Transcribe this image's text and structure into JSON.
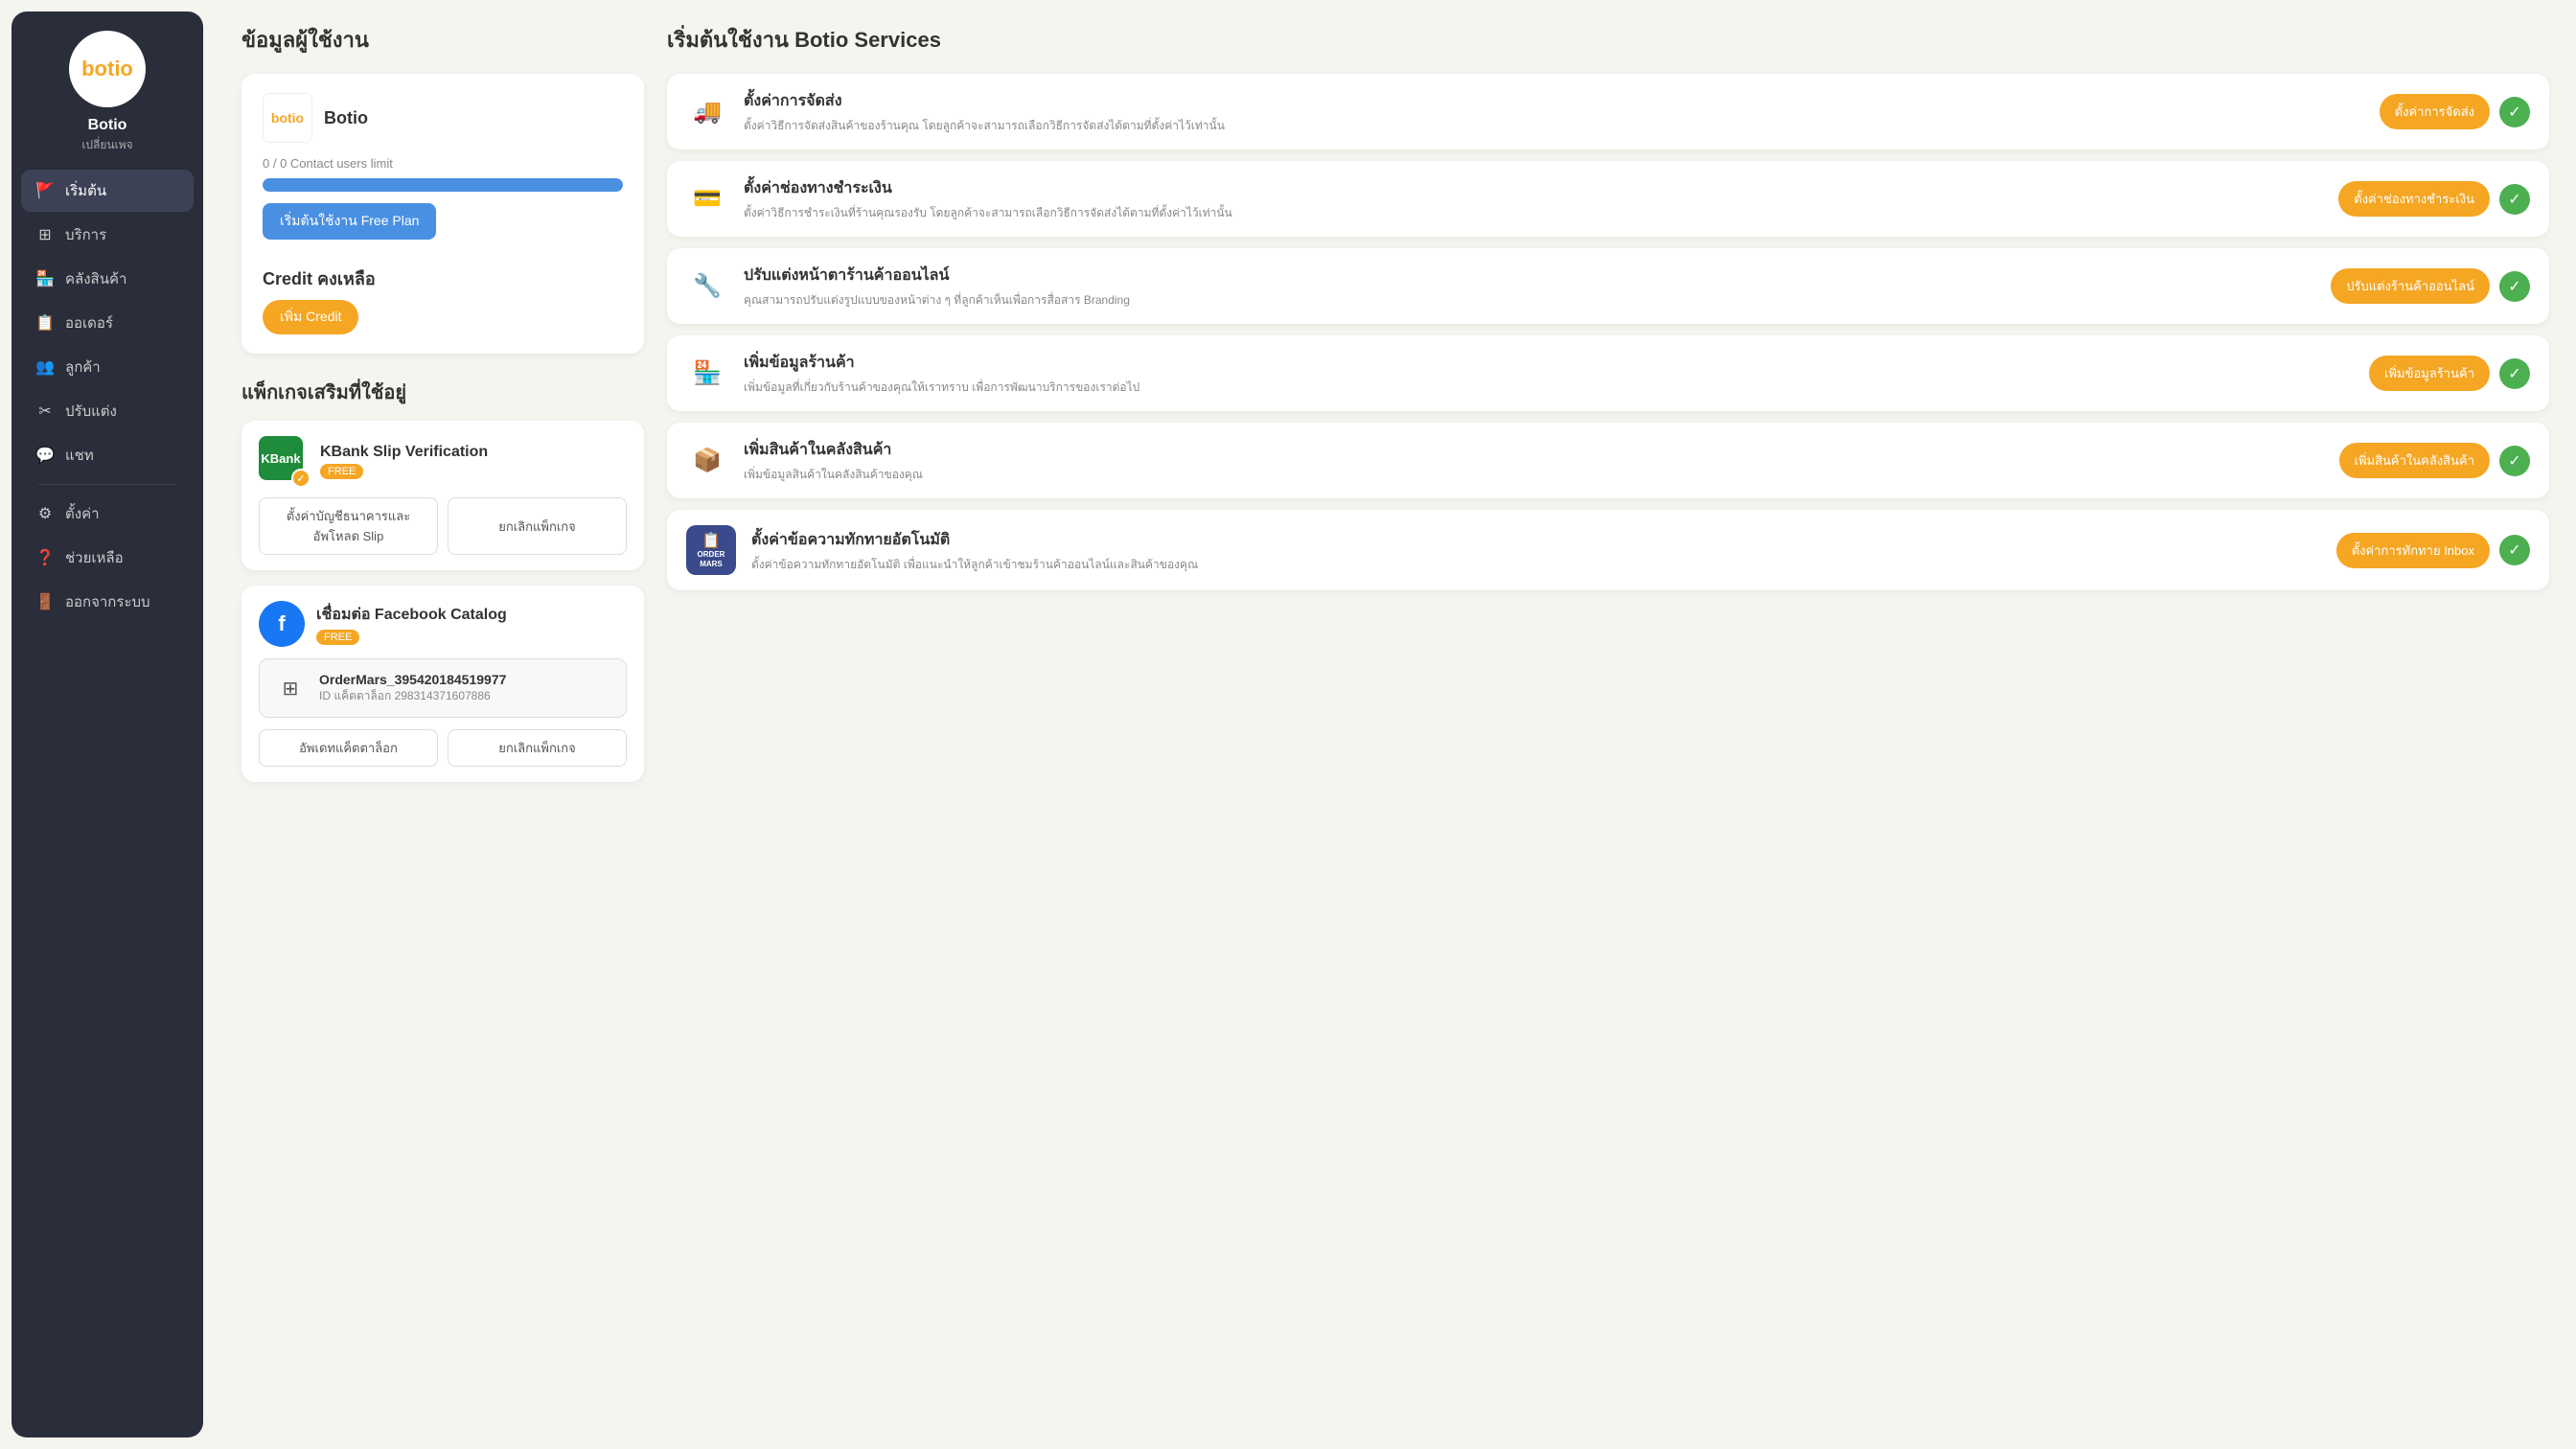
{
  "sidebar": {
    "logo_text_main": "bot",
    "logo_text_accent": "io",
    "username": "Botio",
    "change_page": "เปลี่ยนเพจ",
    "nav_items": [
      {
        "id": "start",
        "label": "เริ่มต้น",
        "icon": "🚩",
        "active": true
      },
      {
        "id": "services",
        "label": "บริการ",
        "icon": "⊞"
      },
      {
        "id": "products",
        "label": "คลังสินค้า",
        "icon": "🏪"
      },
      {
        "id": "orders",
        "label": "ออเดอร์",
        "icon": "📋"
      },
      {
        "id": "customers",
        "label": "ลูกค้า",
        "icon": "👥"
      },
      {
        "id": "customize",
        "label": "ปรับแต่ง",
        "icon": "✂"
      },
      {
        "id": "chat",
        "label": "แชท",
        "icon": "💬"
      },
      {
        "id": "settings",
        "label": "ตั้งค่า",
        "icon": "⚙"
      },
      {
        "id": "help",
        "label": "ช่วยเหลือ",
        "icon": "❓"
      },
      {
        "id": "logout",
        "label": "ออกจากระบบ",
        "icon": "🚪"
      }
    ]
  },
  "user_info": {
    "section_title": "ข้อมูลผู้ใช้งาน",
    "card": {
      "logo_main": "bot",
      "logo_accent": "io",
      "shop_name": "Botio",
      "contact_limit": "0 / 0 Contact users limit",
      "progress_percent": 100,
      "btn_free_plan": "เริ่มต้นใช้งาน Free Plan",
      "credit_label": "Credit คงเหลือ",
      "btn_add_credit": "เพิ่ม Credit"
    }
  },
  "packages": {
    "section_title": "แพ็กเกจเสริมที่ใช้อยู่",
    "items": [
      {
        "id": "kbank",
        "logo_text": "KBank",
        "name": "KBank Slip Verification",
        "badge": "FREE",
        "actions": [
          {
            "id": "setup",
            "label": "ตั้งค่าบัญชีธนาคารและอัพโหลด Slip"
          },
          {
            "id": "cancel",
            "label": "ยกเลิกแพ็กเกจ"
          }
        ]
      },
      {
        "id": "facebook_catalog",
        "logo_icon": "f",
        "name": "เชื่อมต่อ Facebook Catalog",
        "badge": "FREE",
        "catalog": {
          "name": "OrderMars_395420184519977",
          "id_label": "ID แค็ตตาล็อก 298314371607886"
        },
        "actions": [
          {
            "id": "update",
            "label": "อัพเดทแค็ตตาล็อก"
          },
          {
            "id": "cancel",
            "label": "ยกเลิกแพ็กเกจ"
          }
        ]
      }
    ]
  },
  "services": {
    "section_title": "เริ่มต้นใช้งาน Botio Services",
    "items": [
      {
        "id": "shipping",
        "icon": "🚚",
        "title": "ตั้งค่าการจัดส่ง",
        "desc": "ตั้งค่าวิธีการจัดส่งสินค้าของร้านคุณ โดยลูกค้าจะสามารถเลือกวิธีการจัดส่งได้ตามที่ตั้งค่าไว้เท่านั้น",
        "btn_label": "ตั้งค่าการจัดส่ง",
        "done": true
      },
      {
        "id": "payment",
        "icon": "💳",
        "title": "ตั้งค่าช่องทางชำระเงิน",
        "desc": "ตั้งค่าวิธีการชำระเงินที่ร้านคุณรองรับ โดยลูกค้าจะสามารถเลือกวิธีการจัดส่งได้ตามที่ตั้งค่าไว้เท่านั้น",
        "btn_label": "ตั้งค่าช่องทางชำระเงิน",
        "done": true
      },
      {
        "id": "storefront",
        "icon": "🔧",
        "title": "ปรับแต่งหน้าตาร้านค้าออนไลน์",
        "desc": "คุณสามารถปรับแต่งรูปแบบของหน้าต่าง ๆ ที่ลูกค้าเห็นเพื่อการสื่อสาร Branding",
        "btn_label": "ปรับแต่งร้านค้าออนไลน์",
        "done": true
      },
      {
        "id": "store_info",
        "icon": "🏪",
        "title": "เพิ่มข้อมูลร้านค้า",
        "desc": "เพิ่มข้อมูลที่เกี่ยวกับร้านค้าของคุณให้เราทราบ เพื่อการพัฒนาบริการของเราต่อไป",
        "btn_label": "เพิ่มข้อมูลร้านค้า",
        "done": true
      },
      {
        "id": "inventory",
        "icon": "📦",
        "title": "เพิ่มสินค้าในคลังสินค้า",
        "desc": "เพิ่มข้อมูลสินค้าในคลังสินค้าของคุณ",
        "btn_label": "เพิ่มสินค้าในคลังสินค้า",
        "done": true
      },
      {
        "id": "auto_reply",
        "icon": "💬",
        "title": "ตั้งค่าข้อความทักทายอัตโนมัติ",
        "desc": "ตั้งค่าข้อความทักทายอัตโนมัติ เพื่อแนะนำให้ลูกค้าเข้าชมร้านค้าออนไลน์และสินค้าของคุณ",
        "btn_label": "ตั้งค่าการทักทาย Inbox",
        "done": true,
        "special_badge": "ORDER_MARS"
      }
    ]
  }
}
